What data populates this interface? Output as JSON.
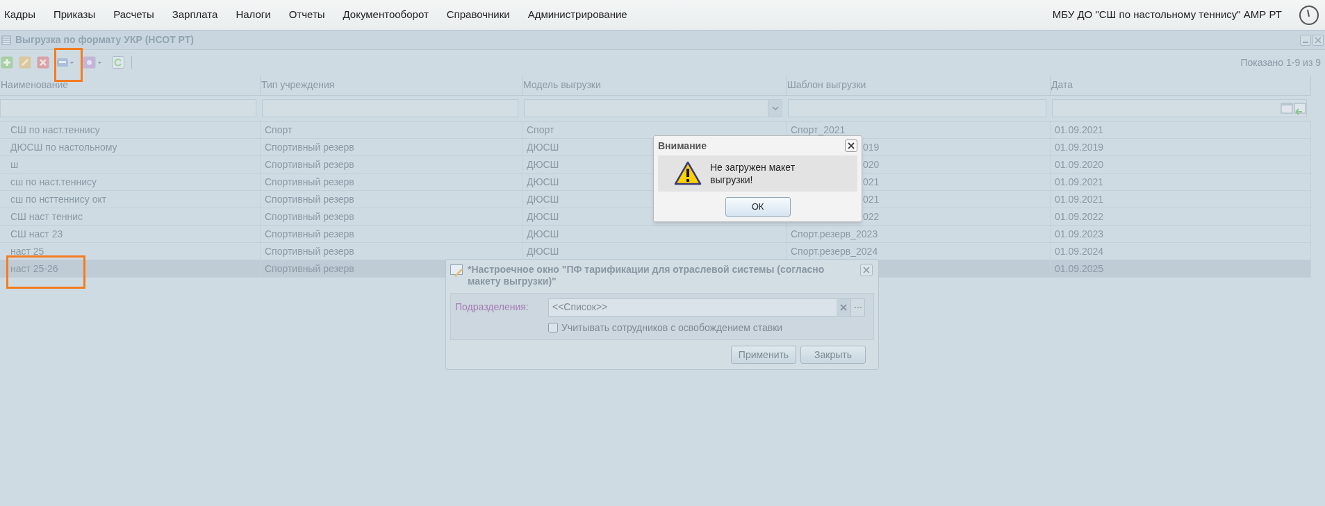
{
  "menu": {
    "items": [
      "Кадры",
      "Приказы",
      "Расчеты",
      "Зарплата",
      "Налоги",
      "Отчеты",
      "Документооборот",
      "Справочники",
      "Администрирование"
    ],
    "organization": "МБУ ДО \"СШ по настольному теннису\" АМР РТ"
  },
  "window": {
    "title": "Выгрузка по формату УКР (НСОТ РТ)",
    "record_count": "Показано 1-9 из 9"
  },
  "table": {
    "columns": [
      "Наименование",
      "Тип учреждения",
      "Модель выгрузки",
      "Шаблон выгрузки",
      "Дата"
    ],
    "rows": [
      {
        "selected": false,
        "cells": [
          "СШ по наст.теннису",
          "Спорт",
          "Спорт",
          "Спорт_2021",
          "01.09.2021"
        ]
      },
      {
        "selected": false,
        "cells": [
          "ДЮСШ по настольному",
          "Спортивный резерв",
          "ДЮСШ",
          "019",
          "01.09.2019"
        ],
        "kind": "partial"
      },
      {
        "selected": false,
        "cells": [
          "ш",
          "Спортивный резерв",
          "ДЮСШ",
          "020",
          "01.09.2020"
        ],
        "kind": "partial"
      },
      {
        "selected": false,
        "cells": [
          "сш по наст.теннису",
          "Спортивный резерв",
          "ДЮСШ",
          "021",
          "01.09.2021"
        ],
        "kind": "partial"
      },
      {
        "selected": false,
        "cells": [
          "сш по нсттеннису окт",
          "Спортивный резерв",
          "ДЮСШ",
          "021",
          "01.09.2021"
        ],
        "kind": "partial"
      },
      {
        "selected": false,
        "cells": [
          "СШ наст теннис",
          "Спортивный резерв",
          "ДЮСШ",
          "022",
          "01.09.2022"
        ],
        "kind": "partial"
      },
      {
        "selected": false,
        "cells": [
          "СШ наст 23",
          "Спортивный резерв",
          "ДЮСШ",
          "Спорт.резерв_2023",
          "01.09.2023"
        ]
      },
      {
        "selected": false,
        "cells": [
          "наст 25",
          "Спортивный резерв",
          "ДЮСШ",
          "Спорт.резерв_2024",
          "01.09.2024"
        ]
      },
      {
        "selected": true,
        "cells": [
          "наст 25-26",
          "Спортивный резерв",
          null,
          null,
          "01.09.2025"
        ]
      }
    ]
  },
  "alert": {
    "title": "Внимание",
    "message": "Не загружен макет выгрузки!",
    "button": "ОК"
  },
  "settings_dialog": {
    "title": "*Настроечное окно \"ПФ тарификации для отраслевой системы (согласно макету выгрузки)\"",
    "field_label": "Подразделения:",
    "field_value": "<<Список>>",
    "checkbox": {
      "label": "Учитывать сотрудников с освобождением ставки",
      "checked": false
    },
    "buttons": [
      "Применить",
      "Закрыть"
    ]
  }
}
